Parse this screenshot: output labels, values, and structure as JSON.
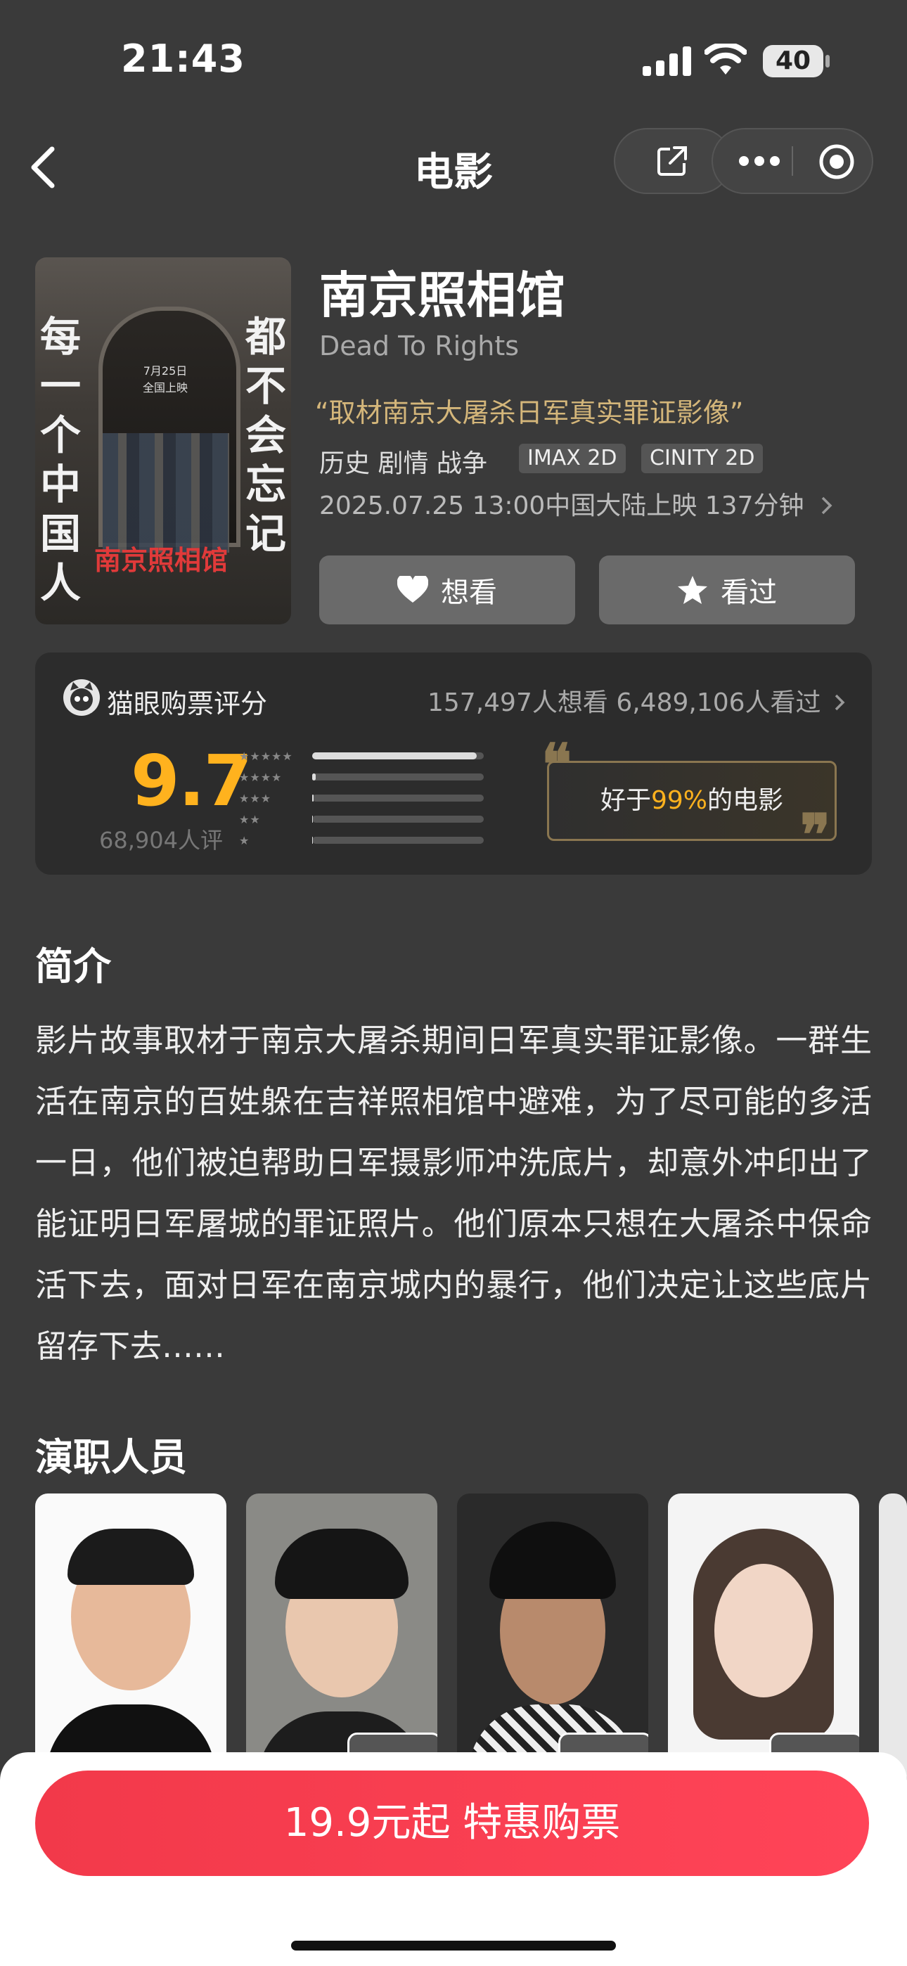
{
  "status_bar": {
    "time": "21:43",
    "battery": "40"
  },
  "nav": {
    "title": "电影"
  },
  "poster": {
    "left_text": [
      "每",
      "一",
      "个",
      "中",
      "国",
      "人"
    ],
    "right_text": [
      "都",
      "不",
      "会",
      "忘",
      "记"
    ],
    "title": "南京照相馆",
    "date": "7月25日 全国上映"
  },
  "movie": {
    "title": "南京照相馆",
    "en_title": "Dead To Rights",
    "tagline": "“取材南京大屠杀日军真实罪证影像”",
    "genres": "历史 剧情 战争",
    "tags": [
      "IMAX 2D",
      "CINITY 2D"
    ],
    "release": "2025.07.25 13:00中国大陆上映 137分钟"
  },
  "actions": {
    "want": "想看",
    "seen": "看过"
  },
  "rating": {
    "source": "猫眼购票评分",
    "stats": "157,497人想看 6,489,106人看过",
    "score": "9.7",
    "count": "68,904人评",
    "distribution": [
      0.96,
      0.02,
      0.01,
      0.005,
      0.005
    ],
    "badge_prefix": "好于",
    "badge_percent": "99%",
    "badge_suffix": "的电影",
    "accent": "#ffb21e"
  },
  "synopsis": {
    "heading": "简介",
    "text": "影片故事取材于南京大屠杀期间日军真实罪证影像。一群生活在南京的百姓躲在吉祥照相馆中避难，为了尽可能的多活一日，他们被迫帮助日军摄影师冲洗底片，却意外冲印出了能证明日军屠城的罪证照片。他们原本只想在大屠杀中保命活下去，面对日军在南京城内的暴行，他们决定让这些底片留存下去……"
  },
  "cast": {
    "heading": "演职人员",
    "count": 4
  },
  "buy": {
    "label": "19.9元起 特惠购票",
    "color": "#f2394a"
  }
}
